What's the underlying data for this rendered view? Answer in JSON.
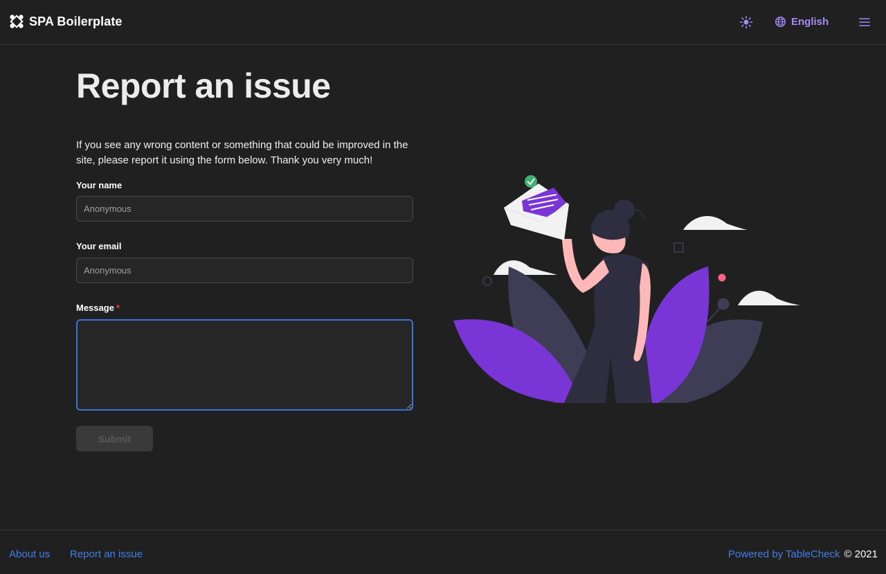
{
  "header": {
    "brand_name": "SPA Boilerplate",
    "logo_icon": "network-logo-icon",
    "theme_icon": "sun-icon",
    "language_label": "English",
    "language_icon": "globe-icon",
    "menu_icon": "hamburger-menu-icon",
    "accent_color": "#a58bf5"
  },
  "main": {
    "title": "Report an issue",
    "intro": "If you see any wrong content or something that could be improved in the site, please report it using the form below. Thank you very much!",
    "form": {
      "name_label": "Your name",
      "name_placeholder": "Anonymous",
      "email_label": "Your email",
      "email_placeholder": "Anonymous",
      "message_label": "Message",
      "required_mark": "*",
      "message_value": "",
      "submit_label": "Submit"
    },
    "illustration_icon": "woman-holding-envelope-illustration",
    "illustration_colors": {
      "purple": "#7a35d6",
      "leaf_gray": "#3f3d56",
      "skin": "#ffb8b8"
    }
  },
  "footer": {
    "links": [
      "About us",
      "Report an issue"
    ],
    "powered_by": "Powered by TableCheck",
    "copyright": "© 2021",
    "link_color": "#3f7fe6"
  }
}
